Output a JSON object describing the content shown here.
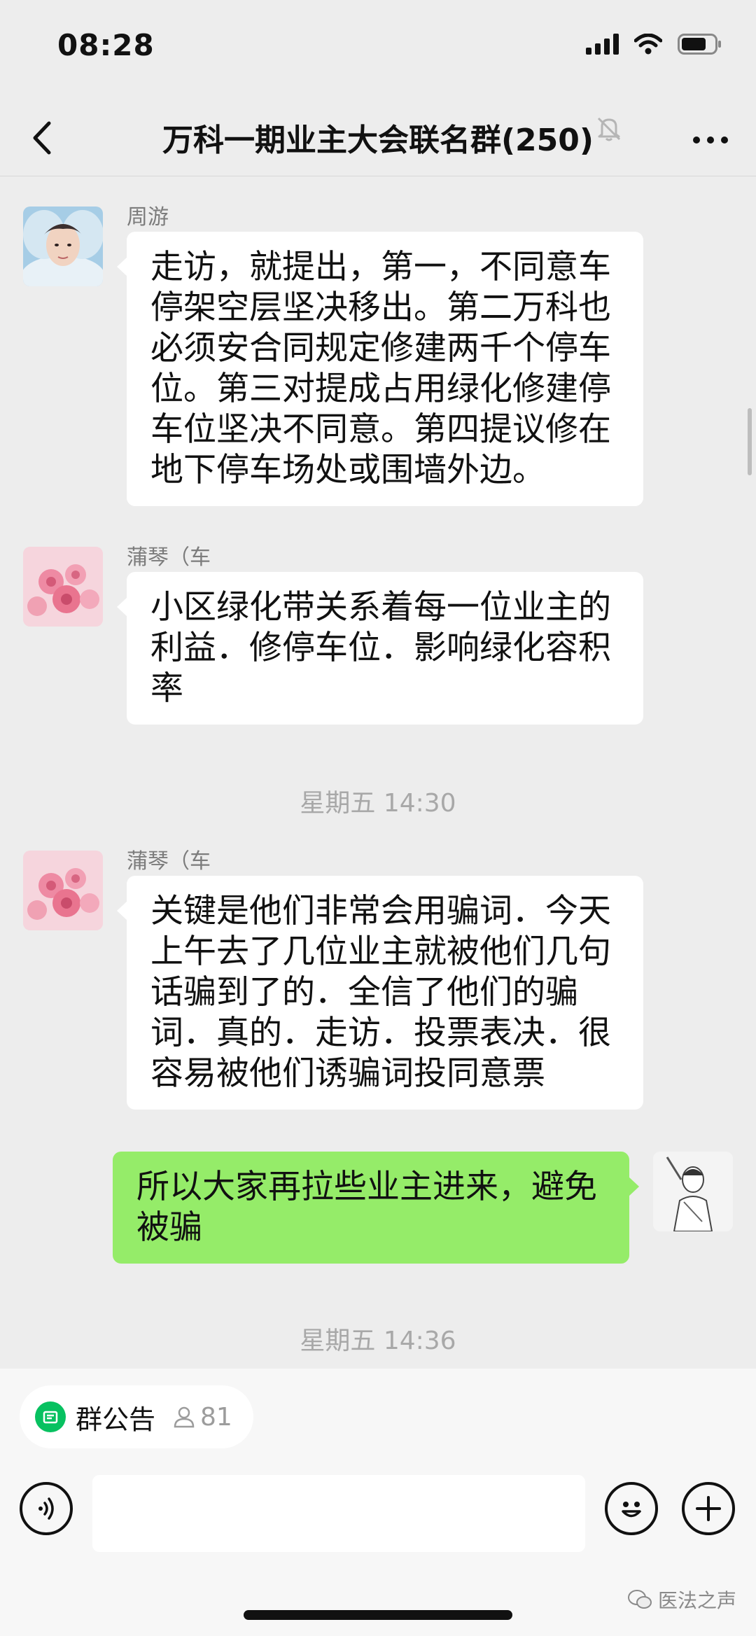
{
  "status_bar": {
    "time": "08:28"
  },
  "header": {
    "title": "万科一期业主大会联名群(250)"
  },
  "messages": [
    {
      "sender": "周游",
      "text": "走访，就提出，第一，不同意车停架空层坚决移出。第二万科也必须安合同规定修建两千个停车位。第三对提成占用绿化修建停车位坚决不同意。第四提议修在地下停车场处或围墙外边。"
    },
    {
      "sender": "蒲琴（车",
      "text": "小区绿化带关系着每一位业主的利益．修停车位．影响绿化容积率"
    },
    {
      "timestamp": "星期五 14:30"
    },
    {
      "sender": "蒲琴（车",
      "text": "关键是他们非常会用骗词．今天上午去了几位业主就被他们几句话骗到了的．全信了他们的骗词．真的．走访．投票表决．很容易被他们诱骗词投同意票"
    },
    {
      "self": true,
      "text": "所以大家再拉些业主进来，避免被骗"
    },
    {
      "timestamp": "星期五 14:36"
    }
  ],
  "notice": {
    "label": "群公告",
    "count": "81"
  },
  "watermark": "医法之声",
  "colors": {
    "self_bubble": "#95ec69",
    "background": "#ededed",
    "accent": "#07c160"
  }
}
